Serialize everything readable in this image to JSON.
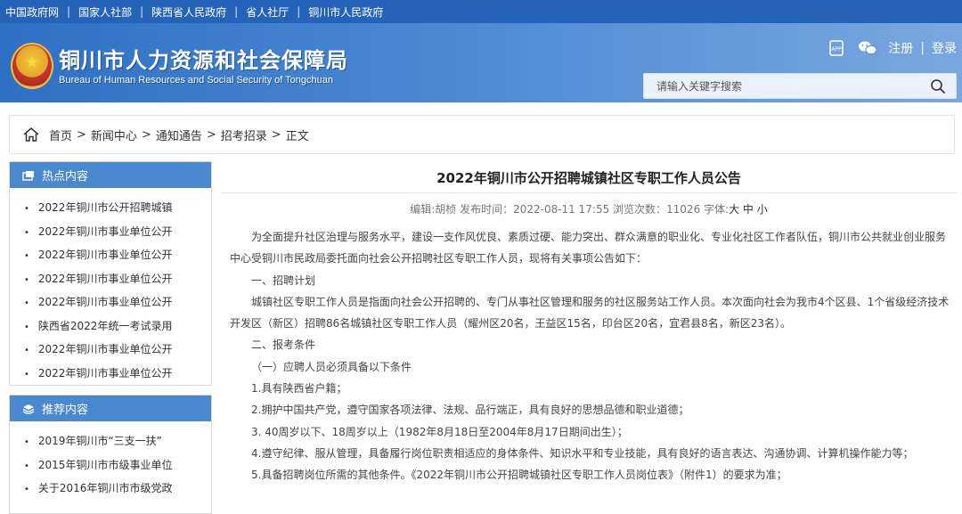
{
  "topbar": {
    "links": [
      "中国政府网",
      "国家人社部",
      "陕西省人民政府",
      "省人社厅",
      "铜川市人民政府"
    ]
  },
  "header": {
    "title": "铜川市人力资源和社会保障局",
    "subtitle": "Bureau of Human Resources and Social Security of Tongchuan",
    "register": "注册",
    "login": "登录",
    "sep": "|",
    "app_icon": "app-icon",
    "wechat_icon": "wechat-icon"
  },
  "search": {
    "placeholder": "请输入关键字搜索"
  },
  "breadcrumb": {
    "items": [
      "首页",
      "新闻中心",
      "通知通告",
      "招考招录",
      "正文"
    ]
  },
  "hot": {
    "title": "热点内容",
    "items": [
      "2022年铜川市公开招聘城镇",
      "2022年铜川市事业单位公开",
      "2022年铜川市事业单位公开",
      "2022年铜川市事业单位公开",
      "2022年铜川市事业单位公开",
      "陕西省2022年统一考试录用",
      "2022年铜川市事业单位公开",
      "2022年铜川市事业单位公开"
    ]
  },
  "recommend": {
    "title": "推荐内容",
    "items": [
      "2019年铜川市“三支一扶”",
      "2015年铜川市市级事业单位",
      "关于2016年铜川市市级党政"
    ]
  },
  "article": {
    "title": "2022年铜川市公开招聘城镇社区专职工作人员公告",
    "meta": "编辑:胡桢 发布时间：2022-08-11 17:55 浏览次数：11026 字体:",
    "font_large": "大",
    "font_medium": "中",
    "font_small": "小",
    "paragraphs": [
      "为全面提升社区治理与服务水平，建设一支作风优良、素质过硬、能力突出、群众满意的职业化、专业化社区工作者队伍，铜川市公共就业创业服务中心受铜川市民政局委托面向社会公开招聘社区专职工作人员，现将有关事项公告如下：",
      "一、招聘计划",
      "城镇社区专职工作人员是指面向社会公开招聘的、专门从事社区管理和服务的社区服务站工作人员。本次面向社会为我市4个区县、1个省级经济技术开发区（新区）招聘86名城镇社区专职工作人员（耀州区20名，王益区15名，印台区20名，宜君县8名，新区23名）。",
      "二、报考条件",
      "（一）应聘人员必须具备以下条件",
      "1.具有陕西省户籍；",
      "2.拥护中国共产党，遵守国家各项法律、法规、品行端正，具有良好的思想品德和职业道德；",
      "3. 40周岁以下、18周岁以上（1982年8月18日至2004年8月17日期间出生）；",
      "4.遵守纪律、服从管理，具备履行岗位职责相适应的身体条件、知识水平和专业技能，具有良好的语言表达、沟通协调、计算机操作能力等；",
      "5.具备招聘岗位所需的其他条件。《2022年铜川市公开招聘城镇社区专职工作人员岗位表》（附件1）的要求为准；"
    ]
  }
}
